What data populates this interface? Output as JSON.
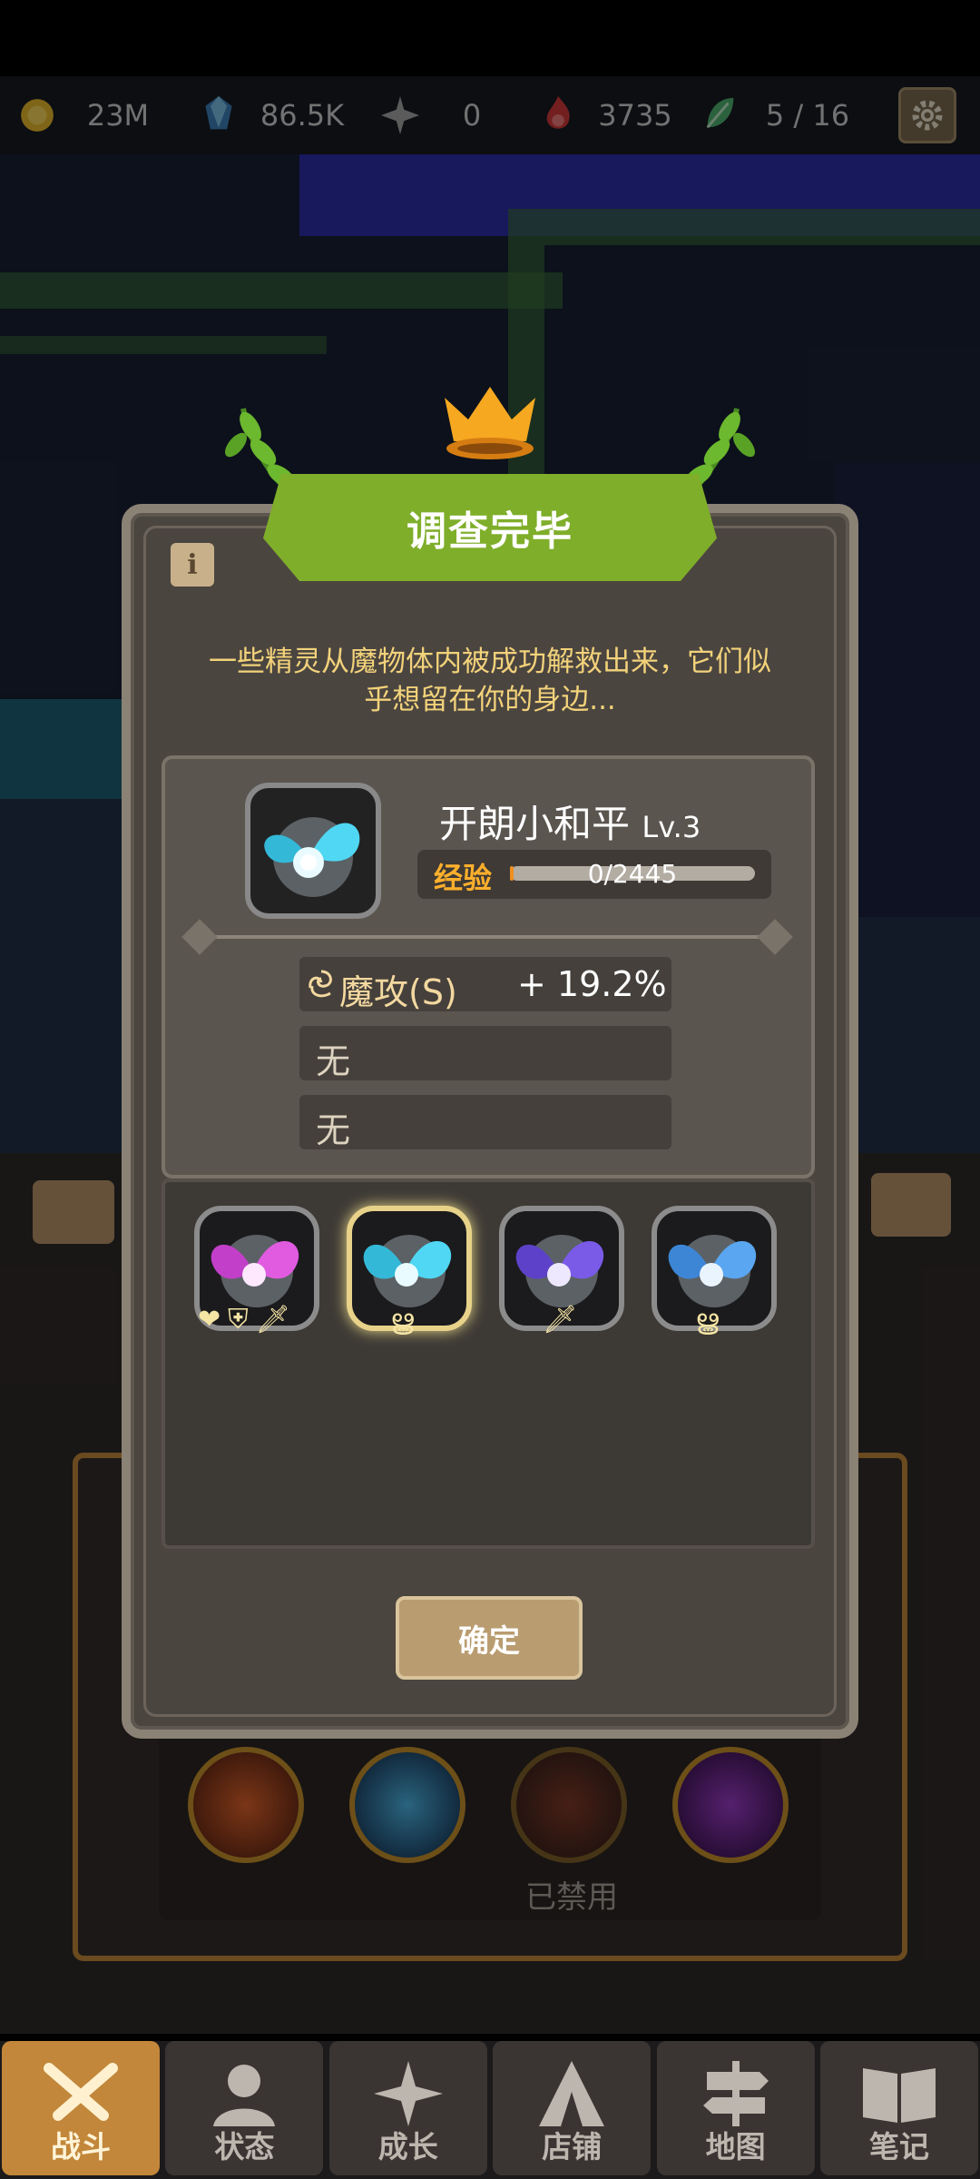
{
  "resources": [
    {
      "icon": "gold-coin-icon",
      "value": "23M"
    },
    {
      "icon": "crystal-icon",
      "value": "86.5K"
    },
    {
      "icon": "star-shard-icon",
      "value": "0"
    },
    {
      "icon": "fire-icon",
      "value": "3735"
    },
    {
      "icon": "leaf-icon",
      "value": "5 / 16"
    }
  ],
  "settings_icon": "gear-icon",
  "dialog": {
    "title": "调查完毕",
    "info_label": "i",
    "description": "一些精灵从魔物体内被成功解救出来，它们似乎想留在你的身边...",
    "spirit": {
      "name": "开朗小和平",
      "level": "Lv.3",
      "exp_label": "经验",
      "exp_text": "0/2445",
      "exp_progress": 0
    },
    "stats": [
      {
        "name": "魔攻(S)",
        "value": "+ 19.2%",
        "icon": "magic-swirl-icon"
      },
      {
        "name": "无"
      },
      {
        "name": "无"
      }
    ],
    "options": [
      {
        "icon": "pink-fairy-icon",
        "tags": [
          "heart-icon",
          "shield-icon",
          "sword-icon"
        ],
        "selected": false
      },
      {
        "icon": "cyan-fairy-icon",
        "tags": [
          "magic-swirl-icon"
        ],
        "selected": true
      },
      {
        "icon": "purple-fairy-icon",
        "tags": [
          "sword-icon"
        ],
        "selected": false
      },
      {
        "icon": "blue-fairy-icon",
        "tags": [
          "magic-swirl-icon"
        ],
        "selected": false
      }
    ],
    "confirm_label": "确定"
  },
  "skills": {
    "disabled_label": "已禁用"
  },
  "nav": [
    {
      "label": "战斗",
      "icon": "crossed-swords-icon",
      "active": true
    },
    {
      "label": "状态",
      "icon": "person-icon",
      "active": false
    },
    {
      "label": "成长",
      "icon": "sparkle-icon",
      "active": false
    },
    {
      "label": "店铺",
      "icon": "tent-icon",
      "active": false
    },
    {
      "label": "地图",
      "icon": "signpost-icon",
      "active": false
    },
    {
      "label": "笔记",
      "icon": "book-icon",
      "active": false
    }
  ],
  "colors": {
    "accent_gold": "#c2873a",
    "banner_green": "#7fae2a",
    "exp_orange": "#ffb02c",
    "desc_yellow": "#f2d27a"
  }
}
